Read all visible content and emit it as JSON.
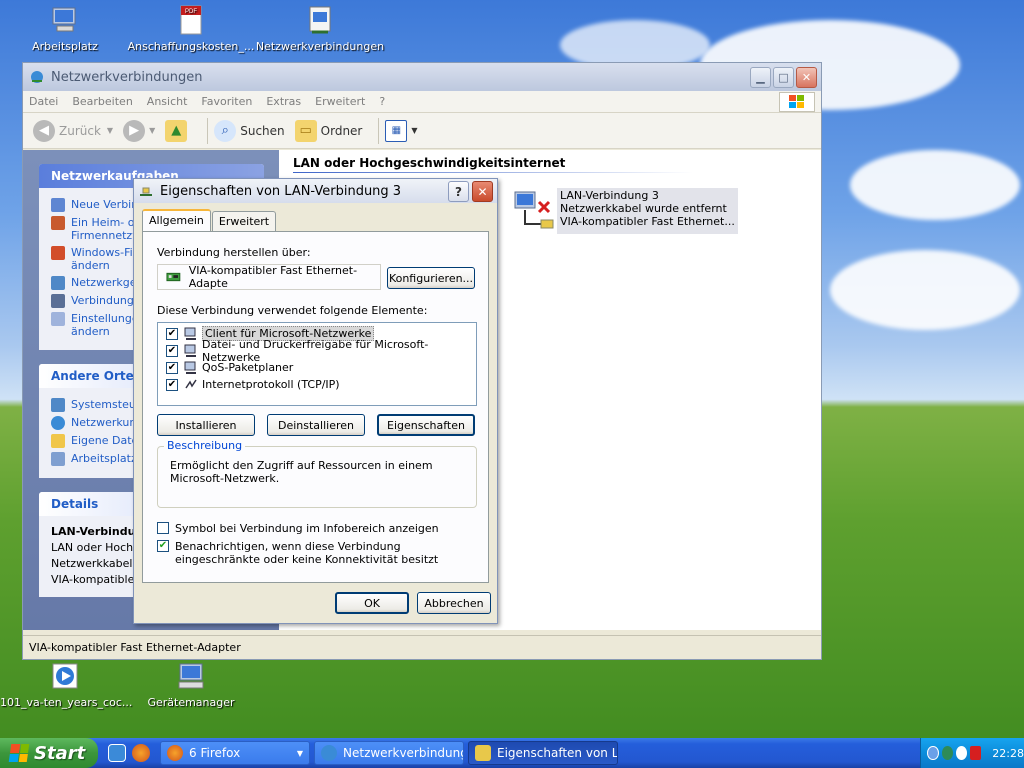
{
  "desktop": {
    "icons_top": [
      {
        "label": "Arbeitsplatz",
        "icon": "computer-icon"
      },
      {
        "label": "Anschaffungskosten_...",
        "icon": "pdf-icon",
        "badge": "PDF"
      },
      {
        "label": "Netzwerkverbindungen",
        "icon": "network-connections-icon"
      }
    ],
    "icons_bottom": [
      {
        "label": "101_va-ten_years_coc...",
        "icon": "media-file-icon"
      },
      {
        "label": "Gerätemanager",
        "icon": "device-manager-icon"
      }
    ]
  },
  "explorer": {
    "title": "Netzwerkverbindungen",
    "menu": [
      "Datei",
      "Bearbeiten",
      "Ansicht",
      "Favoriten",
      "Extras",
      "Erweitert",
      "?"
    ],
    "toolbar": {
      "back": "Zurück",
      "search": "Suchen",
      "folders": "Ordner"
    },
    "tasks_panel": {
      "title": "Netzwerkaufgaben",
      "items": [
        "Neue Verbin",
        "Ein Heim- od\nFirmennetzv",
        "Windows-Fir\nändern",
        "Netzwerkge",
        "Verbindung",
        "Einstellunge\nändern"
      ]
    },
    "other_panel": {
      "title": "Andere Orte",
      "items": [
        "Systemsteu",
        "Netzwerkum",
        "Eigene Date",
        "Arbeitsplatz"
      ]
    },
    "details_panel": {
      "title": "Details",
      "name": "LAN-Verbindun",
      "lines": [
        "LAN oder Hochge",
        "Netzwerkkabel w",
        "VIA-kompatibler"
      ]
    },
    "content": {
      "group_title": "LAN oder Hochgeschwindigkeitsinternet",
      "item": {
        "name": "LAN-Verbindung 3",
        "status": "Netzwerkkabel wurde entfernt",
        "device": "VIA-kompatibler Fast Ethernet..."
      }
    },
    "status": "VIA-kompatibler Fast Ethernet-Adapter"
  },
  "dialog": {
    "title": "Eigenschaften von LAN-Verbindung 3",
    "tabs": [
      "Allgemein",
      "Erweitert"
    ],
    "connect_label": "Verbindung herstellen über:",
    "adapter": "VIA-kompatibler Fast Ethernet-Adapte",
    "configure": "Konfigurieren...",
    "elements_label": "Diese Verbindung verwendet folgende Elemente:",
    "elements": [
      {
        "label": "Client für Microsoft-Netzwerke",
        "checked": true,
        "selected": true
      },
      {
        "label": "Datei- und Druckerfreigabe für Microsoft-Netzwerke",
        "checked": true
      },
      {
        "label": "QoS-Paketplaner",
        "checked": true
      },
      {
        "label": "Internetprotokoll (TCP/IP)",
        "checked": true
      }
    ],
    "install": "Installieren",
    "uninstall": "Deinstallieren",
    "properties": "Eigenschaften",
    "description_title": "Beschreibung",
    "description": "Ermöglicht den Zugriff auf Ressourcen in einem Microsoft-Netzwerk.",
    "show_icon": "Symbol bei Verbindung im Infobereich anzeigen",
    "show_icon_checked": false,
    "notify": "Benachrichtigen, wenn diese Verbindung eingeschränkte oder keine Konnektivität besitzt",
    "notify_checked": true,
    "ok": "OK",
    "cancel": "Abbrechen"
  },
  "taskbar": {
    "start": "Start",
    "buttons": [
      {
        "label": "6 Firefox",
        "count": "6",
        "name": "Firefox"
      },
      {
        "label": "Netzwerkverbindungen"
      },
      {
        "label": "Eigenschaften von LA..."
      }
    ],
    "clock": "22:28"
  }
}
